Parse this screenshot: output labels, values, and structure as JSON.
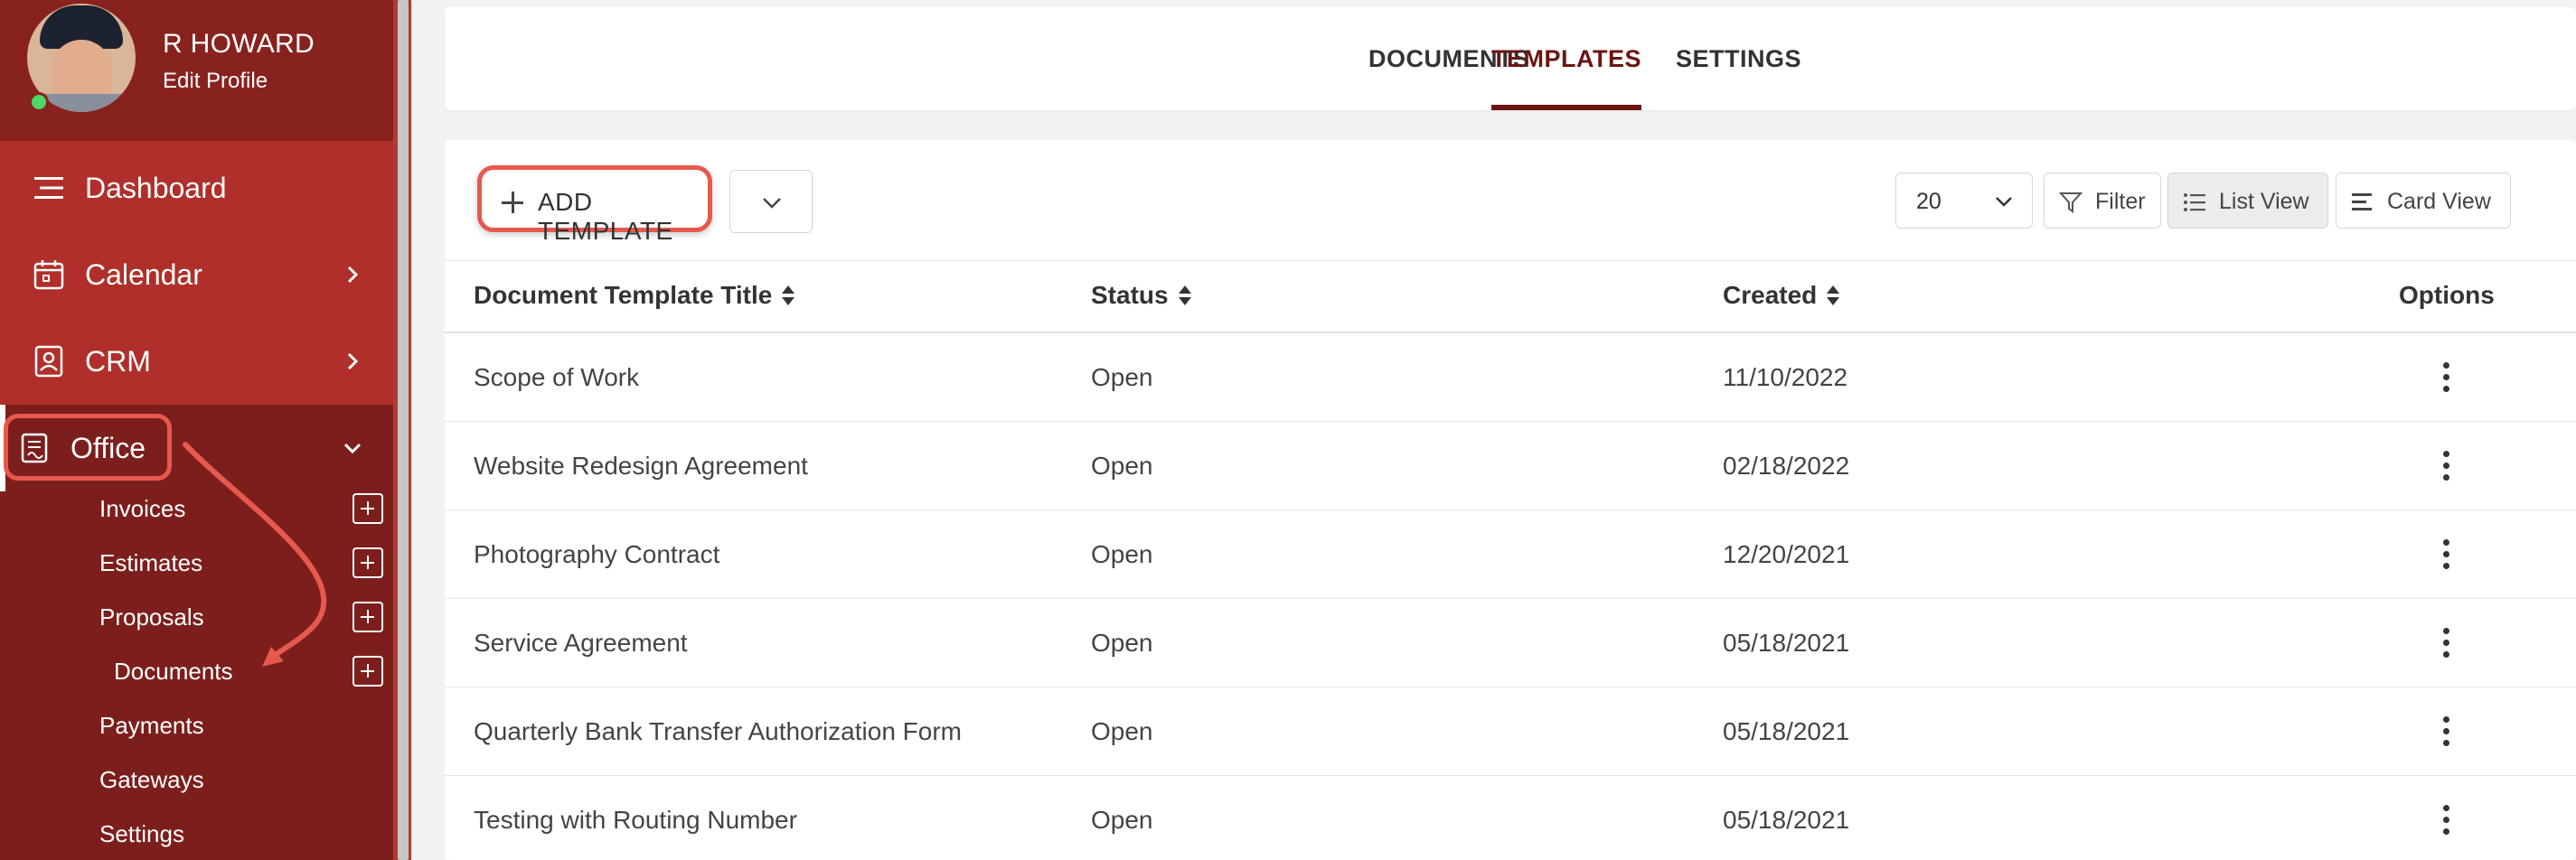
{
  "user": {
    "name": "R HOWARD",
    "edit_profile": "Edit Profile"
  },
  "sidebar": {
    "nav": [
      {
        "label": "Dashboard",
        "icon": "hamburger-icon"
      },
      {
        "label": "Calendar",
        "icon": "calendar-icon"
      },
      {
        "label": "CRM",
        "icon": "contact-card-icon"
      },
      {
        "label": "Office",
        "icon": "office-document-icon"
      }
    ],
    "office_sub": [
      {
        "label": "Invoices",
        "has_add": true
      },
      {
        "label": "Estimates",
        "has_add": true
      },
      {
        "label": "Proposals",
        "has_add": true
      },
      {
        "label": "Documents",
        "has_add": true
      },
      {
        "label": "Payments",
        "has_add": false
      },
      {
        "label": "Gateways",
        "has_add": false
      },
      {
        "label": "Settings",
        "has_add": false
      }
    ]
  },
  "tabs": [
    {
      "label": "DOCUMENTS",
      "active": false
    },
    {
      "label": "TEMPLATES",
      "active": true
    },
    {
      "label": "SETTINGS",
      "active": false
    }
  ],
  "toolbar": {
    "add_label": "ADD TEMPLATE",
    "per_page": "20",
    "filter_label": "Filter",
    "list_view_label": "List View",
    "card_view_label": "Card View"
  },
  "table": {
    "columns": [
      "Document Template Title",
      "Status",
      "Created",
      "Options"
    ],
    "rows": [
      {
        "title": "Scope of Work",
        "status": "Open",
        "created": "11/10/2022"
      },
      {
        "title": "Website Redesign Agreement",
        "status": "Open",
        "created": "02/18/2022"
      },
      {
        "title": "Photography Contract",
        "status": "Open",
        "created": "12/20/2021"
      },
      {
        "title": "Service Agreement",
        "status": "Open",
        "created": "05/18/2021"
      },
      {
        "title": "Quarterly Bank Transfer Authorization Form",
        "status": "Open",
        "created": "05/18/2021"
      },
      {
        "title": "Testing with Routing Number",
        "status": "Open",
        "created": "05/18/2021"
      }
    ]
  },
  "colors": {
    "sidebar_dark": "#7c1f1c",
    "sidebar_red": "#b02f2a",
    "accent": "#6b1512",
    "highlight": "#e8594d"
  }
}
